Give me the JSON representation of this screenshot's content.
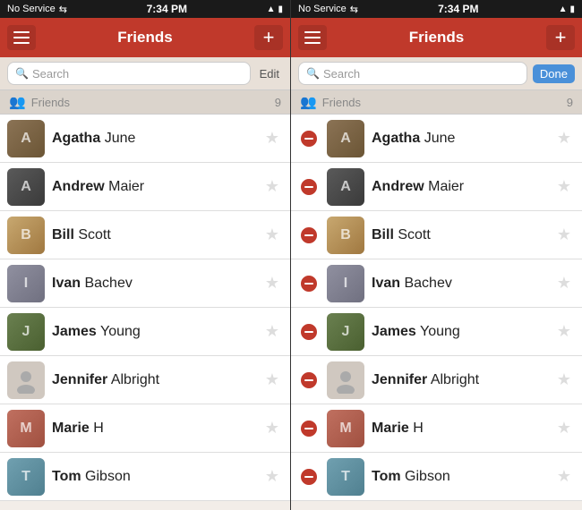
{
  "panels": [
    {
      "id": "panel-normal",
      "status": {
        "left": "No Service",
        "center": "7:34 PM",
        "right": "▲ 1 ▶ ⬡"
      },
      "nav": {
        "title": "Friends",
        "menu_label": "Menu",
        "add_label": "+"
      },
      "search": {
        "placeholder": "Search",
        "action_label": "Edit",
        "mode": "normal"
      },
      "section": {
        "label": "Friends",
        "count": "9"
      },
      "friends": [
        {
          "id": "agatha",
          "first": "Agatha",
          "last": "June",
          "avatar_class": "av-agatha",
          "has_avatar": true
        },
        {
          "id": "andrew",
          "first": "Andrew",
          "last": "Maier",
          "avatar_class": "av-andrew",
          "has_avatar": true
        },
        {
          "id": "bill",
          "first": "Bill",
          "last": "Scott",
          "avatar_class": "av-bill",
          "has_avatar": true
        },
        {
          "id": "ivan",
          "first": "Ivan",
          "last": "Bachev",
          "avatar_class": "av-ivan",
          "has_avatar": true
        },
        {
          "id": "james",
          "first": "James",
          "last": "Young",
          "avatar_class": "av-james",
          "has_avatar": true
        },
        {
          "id": "jennifer",
          "first": "Jennifer",
          "last": "Albright",
          "avatar_class": "",
          "has_avatar": false
        },
        {
          "id": "marie",
          "first": "Marie",
          "last": "H",
          "avatar_class": "av-marie",
          "has_avatar": true
        },
        {
          "id": "tom",
          "first": "Tom",
          "last": "Gibson",
          "avatar_class": "av-tom",
          "has_avatar": true
        }
      ]
    },
    {
      "id": "panel-edit",
      "status": {
        "left": "No Service",
        "center": "7:34 PM",
        "right": "▲ 1 ▶ ⬡"
      },
      "nav": {
        "title": "Friends",
        "menu_label": "Menu",
        "add_label": "+"
      },
      "search": {
        "placeholder": "Search",
        "action_label": "Done",
        "mode": "edit"
      },
      "section": {
        "label": "Friends",
        "count": "9"
      },
      "friends": [
        {
          "id": "agatha",
          "first": "Agatha",
          "last": "June",
          "avatar_class": "av-agatha",
          "has_avatar": true
        },
        {
          "id": "andrew",
          "first": "Andrew",
          "last": "Maier",
          "avatar_class": "av-andrew",
          "has_avatar": true
        },
        {
          "id": "bill",
          "first": "Bill",
          "last": "Scott",
          "avatar_class": "av-bill",
          "has_avatar": true
        },
        {
          "id": "ivan",
          "first": "Ivan",
          "last": "Bachev",
          "avatar_class": "av-ivan",
          "has_avatar": true
        },
        {
          "id": "james",
          "first": "James",
          "last": "Young",
          "avatar_class": "av-james",
          "has_avatar": true
        },
        {
          "id": "jennifer",
          "first": "Jennifer",
          "last": "Albright",
          "avatar_class": "",
          "has_avatar": false
        },
        {
          "id": "marie",
          "first": "Marie",
          "last": "H",
          "avatar_class": "av-marie",
          "has_avatar": true
        },
        {
          "id": "tom",
          "first": "Tom",
          "last": "Gibson",
          "avatar_class": "av-tom",
          "has_avatar": true
        }
      ]
    }
  ]
}
